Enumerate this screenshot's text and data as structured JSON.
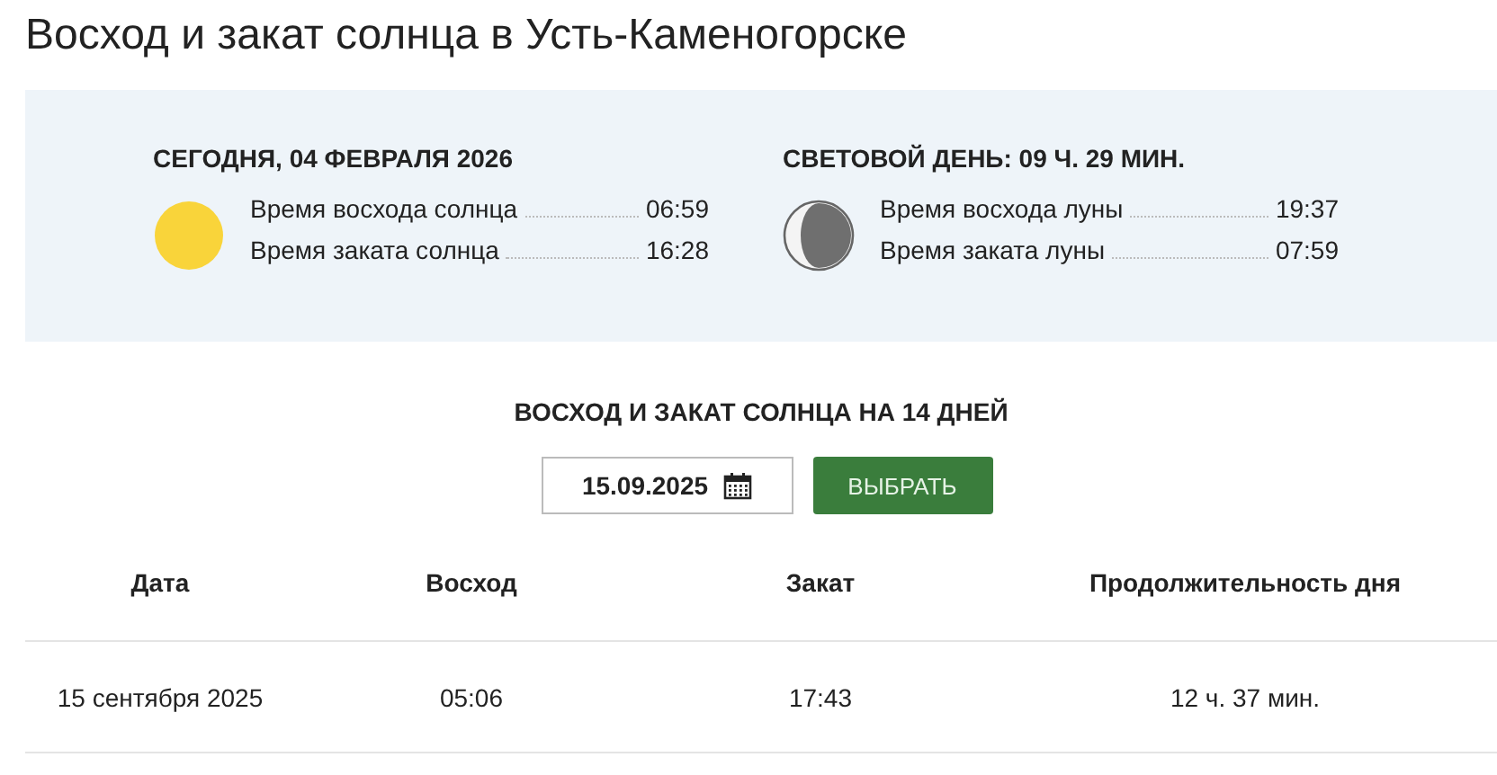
{
  "title": "Восход и закат солнца в Усть-Каменогорске",
  "today": [
    {
      "heading": "СЕГОДНЯ, 04 ФЕВРАЛЯ 2026",
      "kind": "sun",
      "rows": [
        {
          "label": "Время восхода солнца",
          "value": "06:59"
        },
        {
          "label": "Время заката солнца",
          "value": "16:28"
        }
      ]
    },
    {
      "heading": "СВЕТОВОЙ ДЕНЬ: 09 Ч. 29 МИН.",
      "kind": "moon",
      "rows": [
        {
          "label": "Время восхода луны",
          "value": "19:37"
        },
        {
          "label": "Время заката луны",
          "value": "07:59"
        }
      ]
    }
  ],
  "forecast": {
    "heading": "ВОСХОД И ЗАКАТ СОЛНЦА НА 14 ДНЕЙ",
    "date_value": "15.09.2025",
    "button": "ВЫБРАТЬ"
  },
  "table": {
    "columns": [
      "Дата",
      "Восход",
      "Закат",
      "Продолжительность дня"
    ],
    "rows": [
      [
        "15 сентября 2025",
        "05:06",
        "17:43",
        "12 ч. 37 мин."
      ]
    ]
  }
}
